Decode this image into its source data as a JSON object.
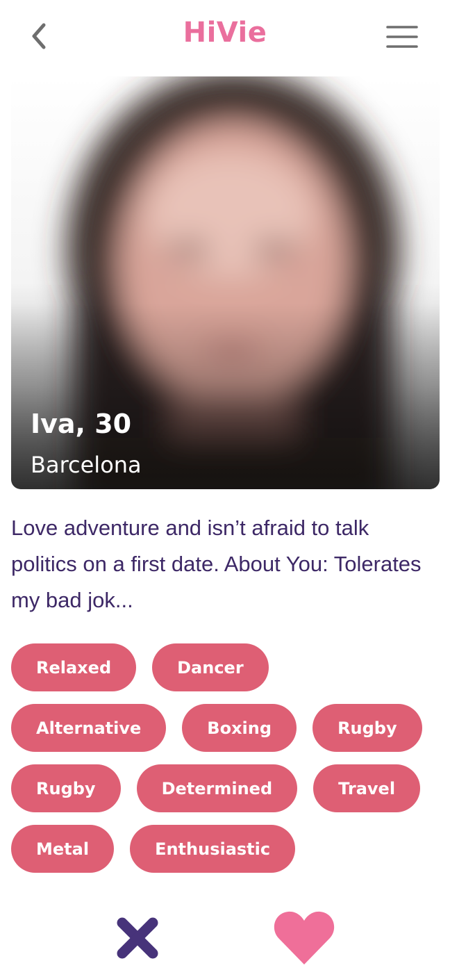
{
  "header": {
    "app_name": "HiVie",
    "back_icon": "chevron-left-icon",
    "menu_icon": "hamburger-menu-icon"
  },
  "profile": {
    "name_age": "Iva, 30",
    "city": "Barcelona",
    "bio": "Love adventure and isn’t afraid to talk politics on a first date. About You: Tolerates my bad jok..."
  },
  "tags": [
    "Relaxed",
    "Dancer",
    "Alternative",
    "Boxing",
    "Rugby",
    "Rugby",
    "Determined",
    "Travel",
    "Metal",
    "Enthusiastic"
  ],
  "actions": {
    "dislike_icon": "close-x-icon",
    "like_icon": "heart-icon"
  },
  "colors": {
    "brand_pink": "#ea6f9d",
    "tag_bg": "#de5f74",
    "text_purple": "#3d2866",
    "icon_gray": "#6e6e6e",
    "dislike_purple": "#47337a",
    "like_pink": "#ef6f99"
  }
}
